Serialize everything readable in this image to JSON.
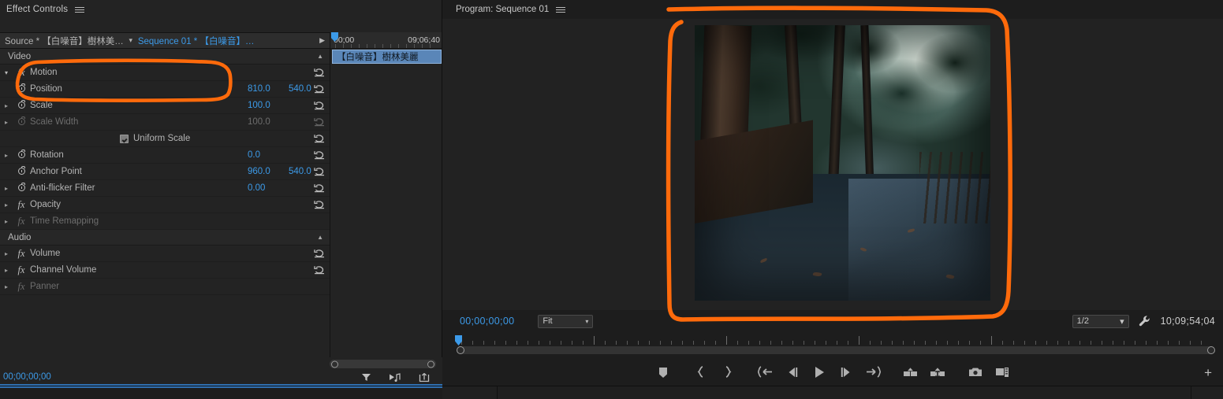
{
  "effect_controls": {
    "panel_title": "Effect Controls",
    "menu_icon": "hamburger-menu-icon",
    "source_tab": "Source * 【白噪音】樹林美…",
    "sequence_tab": "Sequence 01 * 【白噪音】…",
    "video_group": "Video",
    "audio_group": "Audio",
    "uniform_scale_label": "Uniform Scale",
    "timeline": {
      "start_timecode": "00;00",
      "end_timecode": "09;06;40",
      "clip_label": "【白噪音】樹林美麗"
    },
    "footer_timecode": "00;00;00;00",
    "footer_icons": [
      "filter-icon",
      "play-audio-icon",
      "export-icon"
    ],
    "video_properties": [
      {
        "name": "Motion",
        "type": "effect",
        "expanded": true,
        "value1": "",
        "value2": "",
        "enabled": true,
        "highlighted": true
      },
      {
        "name": "Position",
        "type": "prop",
        "value1": "810.0",
        "value2": "540.0",
        "enabled": true,
        "highlighted": true
      },
      {
        "name": "Scale",
        "type": "prop",
        "value1": "100.0",
        "value2": "",
        "enabled": true,
        "highlighted": false
      },
      {
        "name": "Scale Width",
        "type": "prop",
        "value1": "100.0",
        "value2": "",
        "enabled": false,
        "highlighted": false
      },
      {
        "name": "Rotation",
        "type": "prop",
        "value1": "0.0",
        "value2": "",
        "enabled": true,
        "highlighted": false
      },
      {
        "name": "Anchor Point",
        "type": "prop",
        "value1": "960.0",
        "value2": "540.0",
        "enabled": true,
        "highlighted": false
      },
      {
        "name": "Anti-flicker Filter",
        "type": "prop",
        "value1": "0.00",
        "value2": "",
        "enabled": true,
        "highlighted": false
      },
      {
        "name": "Opacity",
        "type": "effect",
        "value1": "",
        "value2": "",
        "enabled": true,
        "highlighted": false
      },
      {
        "name": "Time Remapping",
        "type": "effect",
        "value1": "",
        "value2": "",
        "enabled": false,
        "highlighted": false
      }
    ],
    "audio_properties": [
      {
        "name": "Volume",
        "type": "effect",
        "enabled": true
      },
      {
        "name": "Channel Volume",
        "type": "effect",
        "enabled": true
      },
      {
        "name": "Panner",
        "type": "effect",
        "enabled": false
      }
    ]
  },
  "program_monitor": {
    "panel_title": "Program: Sequence 01",
    "menu_icon": "hamburger-menu-icon",
    "playhead_timecode": "00;00;00;00",
    "zoom_level": "Fit",
    "resolution": "1/2",
    "settings_icon": "wrench-icon",
    "duration_timecode": "10;09;54;04",
    "transport_buttons": [
      {
        "name": "add-marker",
        "glyph": "marker"
      },
      {
        "name": "mark-in",
        "glyph": "in"
      },
      {
        "name": "mark-out",
        "glyph": "out"
      },
      {
        "name": "go-to-in",
        "glyph": "gotoin"
      },
      {
        "name": "step-back",
        "glyph": "stepback"
      },
      {
        "name": "play-stop",
        "glyph": "play"
      },
      {
        "name": "step-forward",
        "glyph": "stepfwd"
      },
      {
        "name": "go-to-out",
        "glyph": "gotoout"
      },
      {
        "name": "lift",
        "glyph": "lift"
      },
      {
        "name": "extract",
        "glyph": "extract"
      },
      {
        "name": "export-frame",
        "glyph": "camera"
      },
      {
        "name": "comparison-view",
        "glyph": "compare"
      }
    ],
    "button-editor-label": "+"
  },
  "annotation": {
    "type": "freehand-highlight",
    "color": "#ff6a0b",
    "regions": [
      "position-property-row",
      "program-monitor-video"
    ]
  },
  "colors": {
    "accent_blue": "#3c9ae8",
    "panel_bg": "#232323",
    "annotation_orange": "#ff6a0b",
    "clip_blue": "#5a86b8"
  }
}
